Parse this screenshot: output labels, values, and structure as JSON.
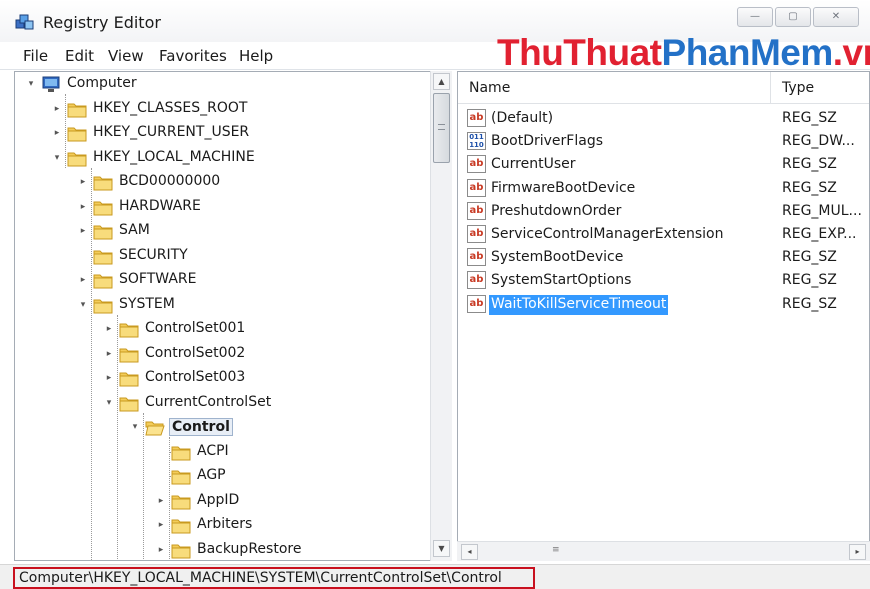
{
  "window": {
    "title": "Registry Editor",
    "minimize_glyph": "—",
    "maximize_glyph": "▢",
    "close_glyph": "✕"
  },
  "watermark": {
    "part1": "ThuThuat",
    "part2": "PhanMem",
    "part3": ".vn"
  },
  "menu": [
    "File",
    "Edit",
    "View",
    "Favorites",
    "Help"
  ],
  "tree": [
    {
      "label": "Computer",
      "icon": "computer-icon",
      "expander": "▾"
    },
    {
      "label": "HKEY_CLASSES_ROOT",
      "icon": "folder-icon",
      "expander": "▸"
    },
    {
      "label": "HKEY_CURRENT_USER",
      "icon": "folder-icon",
      "expander": "▸"
    },
    {
      "label": "HKEY_LOCAL_MACHINE",
      "icon": "folder-icon",
      "expander": "▾"
    },
    {
      "label": "BCD00000000",
      "icon": "folder-icon",
      "expander": "▸"
    },
    {
      "label": "HARDWARE",
      "icon": "folder-icon",
      "expander": "▸"
    },
    {
      "label": "SAM",
      "icon": "folder-icon",
      "expander": "▸"
    },
    {
      "label": "SECURITY",
      "icon": "folder-icon",
      "expander": ""
    },
    {
      "label": "SOFTWARE",
      "icon": "folder-icon",
      "expander": "▸"
    },
    {
      "label": "SYSTEM",
      "icon": "folder-icon",
      "expander": "▾"
    },
    {
      "label": "ControlSet001",
      "icon": "folder-icon",
      "expander": "▸"
    },
    {
      "label": "ControlSet002",
      "icon": "folder-icon",
      "expander": "▸"
    },
    {
      "label": "ControlSet003",
      "icon": "folder-icon",
      "expander": "▸"
    },
    {
      "label": "CurrentControlSet",
      "icon": "folder-icon",
      "expander": "▾"
    },
    {
      "label": "Control",
      "icon": "folder-open-icon",
      "expander": "▾"
    },
    {
      "label": "ACPI",
      "icon": "folder-icon",
      "expander": ""
    },
    {
      "label": "AGP",
      "icon": "folder-icon",
      "expander": ""
    },
    {
      "label": "AppID",
      "icon": "folder-icon",
      "expander": "▸"
    },
    {
      "label": "Arbiters",
      "icon": "folder-icon",
      "expander": "▸"
    },
    {
      "label": "BackupRestore",
      "icon": "folder-icon",
      "expander": "▸"
    }
  ],
  "list": {
    "columns": {
      "name": "Name",
      "type": "Type"
    },
    "rows": [
      {
        "name": "(Default)",
        "type": "REG_SZ",
        "icon": "ab"
      },
      {
        "name": "BootDriverFlags",
        "type": "REG_DW...",
        "icon": "011\n110"
      },
      {
        "name": "CurrentUser",
        "type": "REG_SZ",
        "icon": "ab"
      },
      {
        "name": "FirmwareBootDevice",
        "type": "REG_SZ",
        "icon": "ab"
      },
      {
        "name": "PreshutdownOrder",
        "type": "REG_MUL...",
        "icon": "ab"
      },
      {
        "name": "ServiceControlManagerExtension",
        "type": "REG_EXP...",
        "icon": "ab"
      },
      {
        "name": "SystemBootDevice",
        "type": "REG_SZ",
        "icon": "ab"
      },
      {
        "name": "SystemStartOptions",
        "type": "REG_SZ",
        "icon": "ab"
      },
      {
        "name": "WaitToKillServiceTimeout",
        "type": "REG_SZ",
        "icon": "ab"
      }
    ]
  },
  "scroll": {
    "up": "▲",
    "down": "▼",
    "left": "◂",
    "right": "▸",
    "grip": "≡"
  },
  "status": {
    "path": "Computer\\HKEY_LOCAL_MACHINE\\SYSTEM\\CurrentControlSet\\Control"
  }
}
